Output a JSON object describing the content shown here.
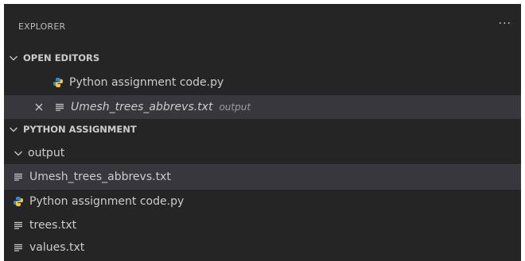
{
  "explorer": {
    "title": "EXPLORER",
    "more_actions": "···"
  },
  "open_editors": {
    "header": "OPEN EDITORS",
    "items": [
      {
        "label": "Python assignment code.py",
        "icon": "python-icon"
      },
      {
        "label": "Umesh_trees_abbrevs.txt",
        "description": "output",
        "icon": "text-file-icon",
        "close_icon": "close-icon"
      }
    ]
  },
  "workspace": {
    "header": "PYTHON ASSIGNMENT",
    "folder": {
      "label": "output",
      "children": [
        {
          "label": "Umesh_trees_abbrevs.txt",
          "icon": "text-file-icon"
        }
      ]
    },
    "files": [
      {
        "label": "Python assignment code.py",
        "icon": "python-icon"
      },
      {
        "label": "trees.txt",
        "icon": "text-file-icon"
      },
      {
        "label": "values.txt",
        "icon": "text-file-icon"
      }
    ]
  },
  "colors": {
    "background": "#252526",
    "selected": "#37373d",
    "text": "#cccccc",
    "python_blue": "#3b87c9",
    "python_yellow": "#f4ca3a"
  }
}
